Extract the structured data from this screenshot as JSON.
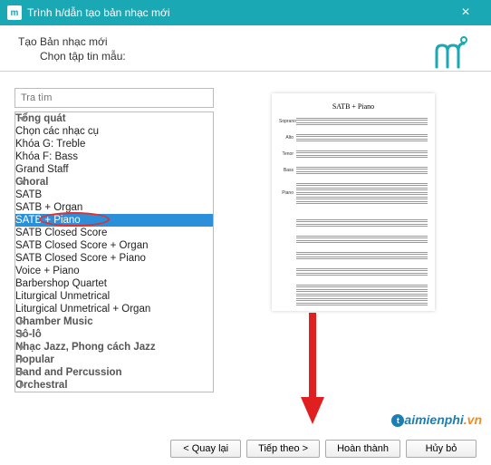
{
  "titlebar": {
    "icon_text": "m",
    "title": "Trình h/dẫn tạo bản nhạc mới"
  },
  "header": {
    "line1": "Tạo Bản nhạc mới",
    "line2": "Chọn tập tin mẫu:"
  },
  "search": {
    "placeholder": "Tra tìm"
  },
  "tree": {
    "cat1": "Tổng quát",
    "cat1_items": {
      "i0": "Chọn các nhạc cụ",
      "i1": "Khóa G: Treble",
      "i2": "Khóa F: Bass",
      "i3": "Grand Staff"
    },
    "cat2": "Choral",
    "cat2_items": {
      "i0": "SATB",
      "i1": "SATB + Organ",
      "i2": "SATB + Piano",
      "i3": "SATB Closed Score",
      "i4": "SATB Closed Score + Organ",
      "i5": "SATB Closed Score + Piano",
      "i6": "Voice + Piano",
      "i7": "Barbershop Quartet",
      "i8": "Liturgical Unmetrical",
      "i9": "Liturgical Unmetrical + Organ"
    },
    "cat3": "Chamber Music",
    "cat4": "Sô-lô",
    "cat5": "Nhạc Jazz, Phong cách Jazz",
    "cat6": "Popular",
    "cat7": "Band and Percussion",
    "cat8": "Orchestral"
  },
  "preview": {
    "title": "SATB + Piano",
    "parts": {
      "p0": "Soprano",
      "p1": "Alto",
      "p2": "Tenor",
      "p3": "Bass",
      "p4": "Piano"
    }
  },
  "footer": {
    "back": "< Quay lại",
    "next": "Tiếp theo >",
    "finish": "Hoàn thành",
    "cancel": "Hủy bỏ"
  },
  "watermark": {
    "t1": "aimienphi",
    "t2": ".vn"
  }
}
